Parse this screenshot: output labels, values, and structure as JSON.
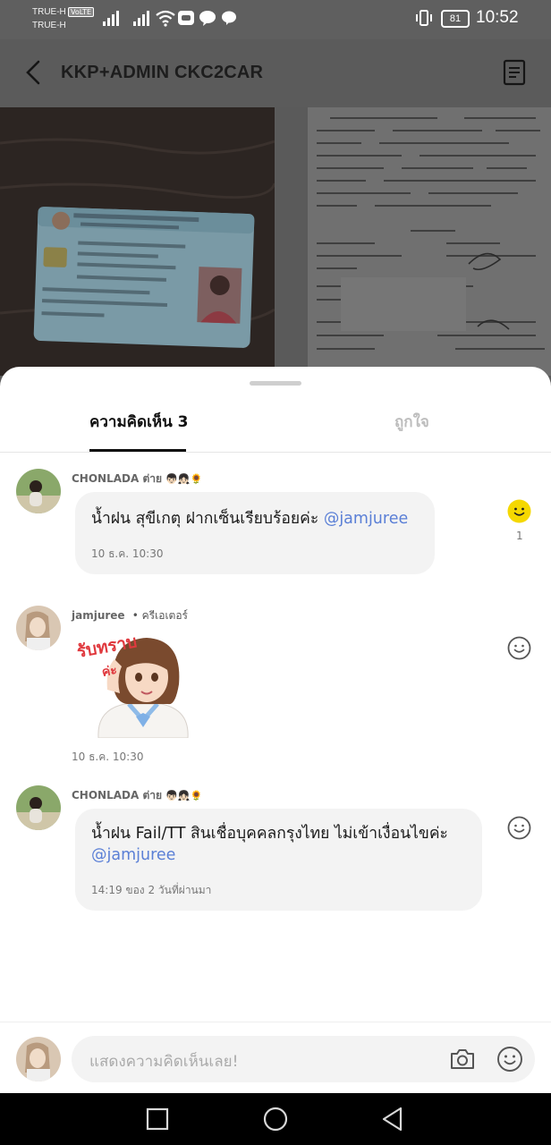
{
  "status_bar": {
    "carrier_1": "TRUE-H",
    "carrier_2": "TRUE-H",
    "volte": "VoLTE",
    "battery": "81",
    "time": "10:52",
    "icons": [
      "signal-icon",
      "wifi-icon",
      "line-app-icon",
      "chat-icon",
      "vibrate-icon",
      "battery-icon"
    ]
  },
  "header": {
    "title": "KKP+ADMIN CKC2CAR",
    "back_icon": "chevron-left-icon",
    "menu_icon": "document-list-icon"
  },
  "tabs": {
    "comments_label": "ความคิดเห็น 3",
    "likes_label": "ถูกใจ"
  },
  "comments": [
    {
      "author": "CHONLADA ต่าย",
      "author_emoji": "👦🏻👧🏻🌻",
      "text": "น้ำฝน สุขีเกตุ  ฝากเซ็นเรียบร้อยค่ะ",
      "mention": "@jamjuree",
      "timestamp": "10 ธ.ค. 10:30",
      "reaction_count": "1",
      "reacted": true
    },
    {
      "author": "jamjuree",
      "badge": "• ครีเอเตอร์",
      "sticker_text_1": "รับทราบ",
      "sticker_text_2": "ค่ะ",
      "timestamp": "10 ธ.ค. 10:30",
      "reacted": false
    },
    {
      "author": "CHONLADA ต่าย",
      "author_emoji": "👦🏻👧🏻🌻",
      "text": "น้ำฝน Fail/TT สินเชื่อบุคคลกรุงไทย ไม่เข้าเงื่อนไขค่ะ",
      "mention": "@jamjuree",
      "timestamp": "14:19 ของ 2 วันที่ผ่านมา",
      "reacted": false
    }
  ],
  "input": {
    "placeholder": "แสดงความคิดเห็นเลย!"
  },
  "colors": {
    "mention": "#5a7fd6",
    "reaction_active": "#f5d800",
    "bubble": "#f3f3f3"
  }
}
